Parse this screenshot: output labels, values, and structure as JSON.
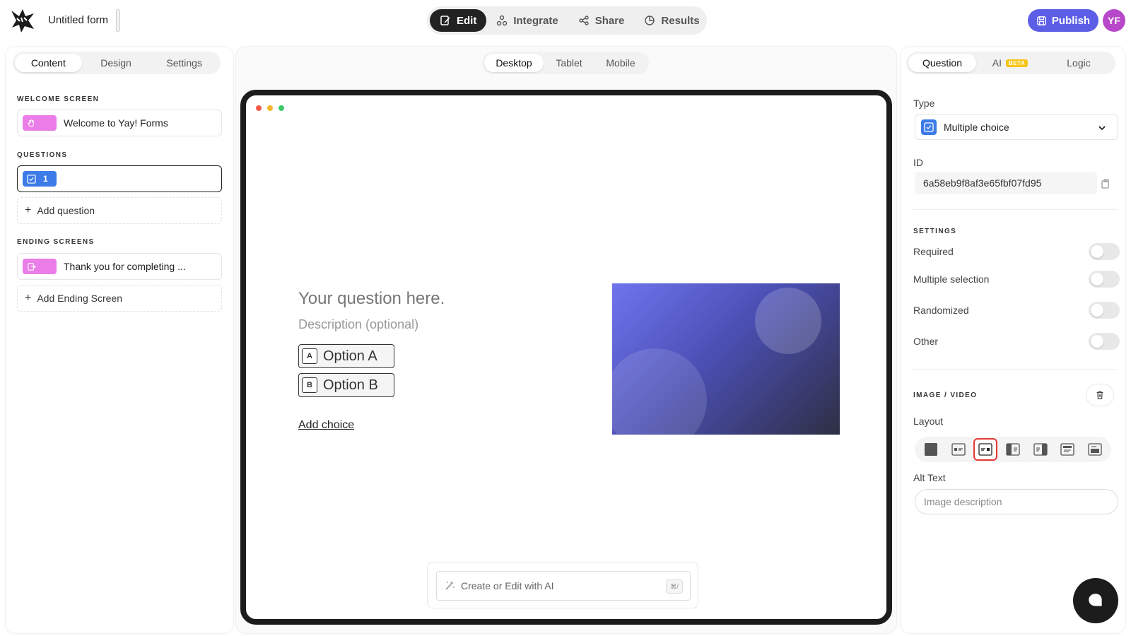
{
  "header": {
    "form_title": "Untitled form",
    "modes": [
      {
        "label": "Edit",
        "icon": "edit-icon"
      },
      {
        "label": "Integrate",
        "icon": "integrate-icon"
      },
      {
        "label": "Share",
        "icon": "share-icon"
      },
      {
        "label": "Results",
        "icon": "results-icon"
      }
    ],
    "active_mode": "Edit",
    "publish_label": "Publish",
    "avatar_initials": "YF"
  },
  "left_panel": {
    "tabs": [
      "Content",
      "Design",
      "Settings"
    ],
    "active_tab": "Content",
    "welcome_label": "WELCOME SCREEN",
    "welcome_item": "Welcome to Yay! Forms",
    "questions_label": "QUESTIONS",
    "question_number": "1",
    "add_question": "Add question",
    "ending_label": "ENDING SCREENS",
    "ending_item": "Thank you for completing ...",
    "add_ending": "Add Ending Screen"
  },
  "center": {
    "devices": [
      "Desktop",
      "Tablet",
      "Mobile"
    ],
    "active_device": "Desktop",
    "question_title": "Your question here.",
    "question_desc": "Description (optional)",
    "options": [
      {
        "key": "A",
        "label": "Option A"
      },
      {
        "key": "B",
        "label": "Option B"
      }
    ],
    "add_choice": "Add choice",
    "ai_placeholder": "Create or Edit with AI",
    "ai_shortcut": "⌘/"
  },
  "right_panel": {
    "tabs": [
      "Question",
      "AI",
      "Logic"
    ],
    "ai_badge": "BETA",
    "active_tab": "Question",
    "type_label": "Type",
    "type_value": "Multiple choice",
    "id_label": "ID",
    "id_value": "6a58eb9f8af3e65fbf07fd95",
    "settings_label": "SETTINGS",
    "settings": [
      {
        "label": "Required",
        "on": false
      },
      {
        "label": "Multiple selection",
        "on": false
      },
      {
        "label": "Randomized",
        "on": false
      },
      {
        "label": "Other",
        "on": false
      }
    ],
    "media_label": "IMAGE / VIDEO",
    "layout_label": "Layout",
    "layout_options": [
      "layout-full-icon",
      "layout-image-left-icon",
      "layout-image-right-icon",
      "layout-split-left-icon",
      "layout-split-right-icon",
      "layout-top-icon",
      "layout-background-icon"
    ],
    "active_layout_index": 2,
    "alt_text_label": "Alt Text",
    "alt_text_placeholder": "Image description"
  },
  "colors": {
    "accent": "#5c5fe6",
    "avatar": "#b748c9",
    "dark": "#1c1c1c",
    "chip_pink": "#ea7de7",
    "chip_blue": "#3c7be8",
    "highlight": "#e53935"
  }
}
